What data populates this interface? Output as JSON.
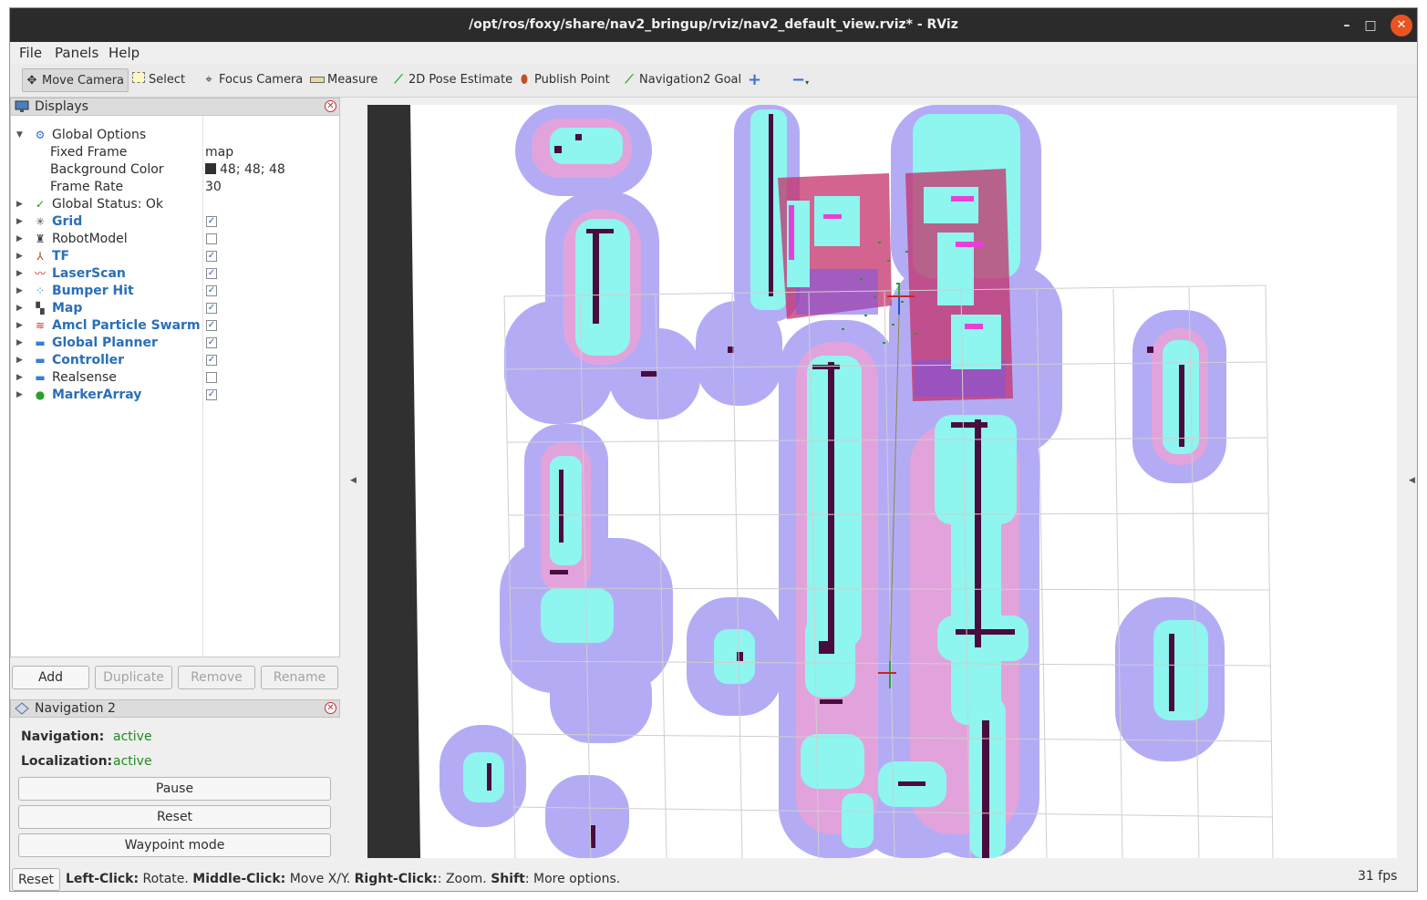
{
  "window": {
    "title": "/opt/ros/foxy/share/nav2_bringup/rviz/nav2_default_view.rviz* - RViz",
    "controls": [
      "–",
      "□",
      "✕"
    ]
  },
  "menubar": {
    "file": "File",
    "panels": "Panels",
    "help": "Help"
  },
  "toolbar": {
    "move_camera": "Move Camera",
    "select": "Select",
    "focus_camera": "Focus Camera",
    "measure": "Measure",
    "pose_estimate": "2D Pose Estimate",
    "publish_point": "Publish Point",
    "nav_goal": "Navigation2 Goal"
  },
  "displays": {
    "title": "Displays",
    "global_options": "Global Options",
    "fixed_frame_label": "Fixed Frame",
    "fixed_frame_value": "map",
    "bg_color_label": "Background Color",
    "bg_color_value": "48; 48; 48",
    "bg_color_hex": "#303030",
    "frame_rate_label": "Frame Rate",
    "frame_rate_value": "30",
    "global_status": "Global Status: Ok",
    "items": [
      {
        "label": "Grid",
        "checked": true,
        "icon": "grid-icon"
      },
      {
        "label": "RobotModel",
        "checked": false,
        "icon": "robot-icon"
      },
      {
        "label": "TF",
        "checked": true,
        "icon": "tf-icon"
      },
      {
        "label": "LaserScan",
        "checked": true,
        "icon": "laser-icon"
      },
      {
        "label": "Bumper Hit",
        "checked": true,
        "icon": "bumper-icon"
      },
      {
        "label": "Map",
        "checked": true,
        "icon": "map-icon"
      },
      {
        "label": "Amcl Particle Swarm",
        "checked": true,
        "icon": "particle-icon"
      },
      {
        "label": "Global Planner",
        "checked": true,
        "icon": "folder-icon"
      },
      {
        "label": "Controller",
        "checked": true,
        "icon": "folder-icon"
      },
      {
        "label": "Realsense",
        "checked": false,
        "icon": "folder-icon"
      },
      {
        "label": "MarkerArray",
        "checked": true,
        "icon": "marker-icon"
      }
    ],
    "buttons": {
      "add": "Add",
      "duplicate": "Duplicate",
      "remove": "Remove",
      "rename": "Rename"
    }
  },
  "navigation": {
    "title": "Navigation 2",
    "nav_label": "Navigation:",
    "nav_value": "active",
    "loc_label": "Localization:",
    "loc_value": "active",
    "pause": "Pause",
    "reset": "Reset",
    "waypoint": "Waypoint mode"
  },
  "statusbar": {
    "reset": "Reset",
    "left_click_key": "Left-Click:",
    "left_click_text": " Rotate. ",
    "middle_click_key": "Middle-Click:",
    "middle_click_text": " Move X/Y. ",
    "right_click_key": "Right-Click:",
    "right_click_text": ": Zoom. ",
    "shift_key": "Shift",
    "shift_text": ": More options.",
    "fps": "31 fps"
  },
  "colors": {
    "inflation": "#b3acf5",
    "inflation_core": "#e69ad0",
    "obstacle_margin": "#8ef5ef",
    "obstacle": "#4a0b3d",
    "local_costmap": "#c4306a"
  }
}
